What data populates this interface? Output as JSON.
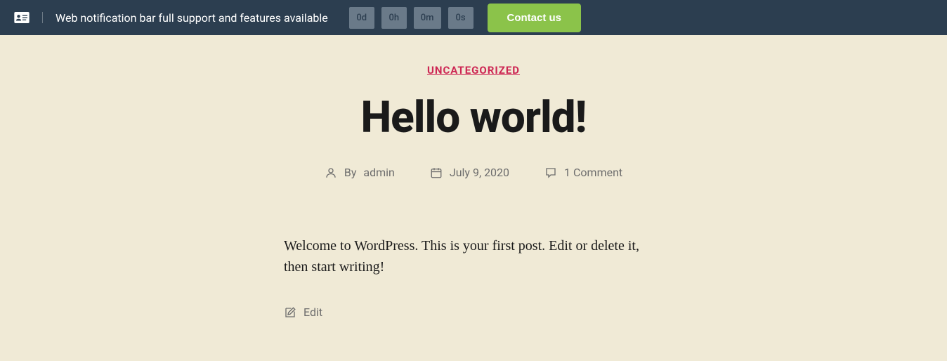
{
  "notification": {
    "text": "Web notification bar full support and features available",
    "countdown": {
      "d": "0d",
      "h": "0h",
      "m": "0m",
      "s": "0s"
    },
    "cta": "Contact us"
  },
  "post": {
    "category": "UNCATEGORIZED",
    "title": "Hello world!",
    "by_label": "By",
    "author": "admin",
    "date": "July 9, 2020",
    "comments": "1 Comment",
    "content": "Welcome to WordPress. This is your first post. Edit or delete it, then start writing!",
    "edit_label": "Edit"
  }
}
